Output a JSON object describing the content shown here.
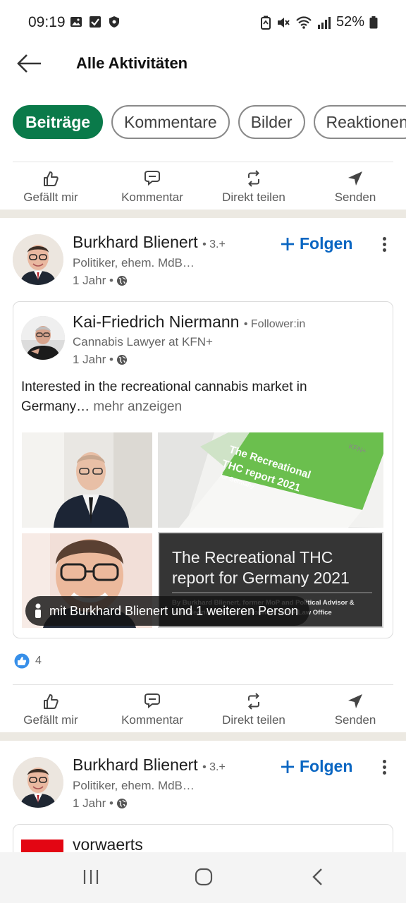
{
  "status_bar": {
    "time": "09:19",
    "battery": "52%",
    "left_icons": [
      "image-icon",
      "checkbox-icon",
      "shield-icon"
    ],
    "right_icons": [
      "battery-saver-icon",
      "mute-icon",
      "wifi-icon",
      "signal-icon",
      "battery-icon"
    ]
  },
  "header": {
    "title": "Alle Aktivitäten",
    "back_icon": "arrow-left-icon"
  },
  "filters": {
    "chips": [
      "Beiträge",
      "Kommentare",
      "Bilder",
      "Reaktionen"
    ],
    "active": "Beiträge"
  },
  "action_bar": {
    "like": "Gefällt mir",
    "comment": "Kommentar",
    "repost": "Direkt teilen",
    "send": "Senden"
  },
  "posts": [
    {
      "author": "Burkhard Blienert",
      "degree": "• 3.+",
      "headline": "Politiker, ehem. MdB…",
      "time": "1 Jahr •",
      "follow": "Folgen",
      "shared": {
        "author": "Kai-Friedrich Niermann",
        "relation": "• Follower:in",
        "headline": "Cannabis Lawyer at KFN+",
        "time": "1 Jahr •",
        "text": "Interested in the recreational cannabis market in Germany",
        "ellipsis": "…",
        "more": "mehr anzeigen",
        "report_cover": {
          "line1": "The Recreational",
          "line2": "THC report 2021",
          "line3": "for Germany",
          "brand": "KFN+"
        },
        "report_slide": {
          "title": "The Recreational THC report for Germany 2021",
          "byline": "By Burkhard Blienert, former MoP and Political Advisor &",
          "byline2": "Kai-Friedrich Niermann, Founder KFN+ Law Office"
        },
        "tag_text": "mit Burkhard Blienert und 1 weiteren Person"
      },
      "reaction_count": "4"
    },
    {
      "author": "Burkhard Blienert",
      "degree": "• 3.+",
      "headline": "Politiker, ehem. MdB…",
      "time": "1 Jahr •",
      "follow": "Folgen",
      "shared_author": "vorwaerts"
    }
  ],
  "colors": {
    "accent_green": "#0a7a4a",
    "link_blue": "#0a66c2",
    "like_blue": "#378fe9",
    "separator": "#ece9e2",
    "cover_green": "#6bbf4e",
    "vorwaerts_red": "#e30613"
  }
}
